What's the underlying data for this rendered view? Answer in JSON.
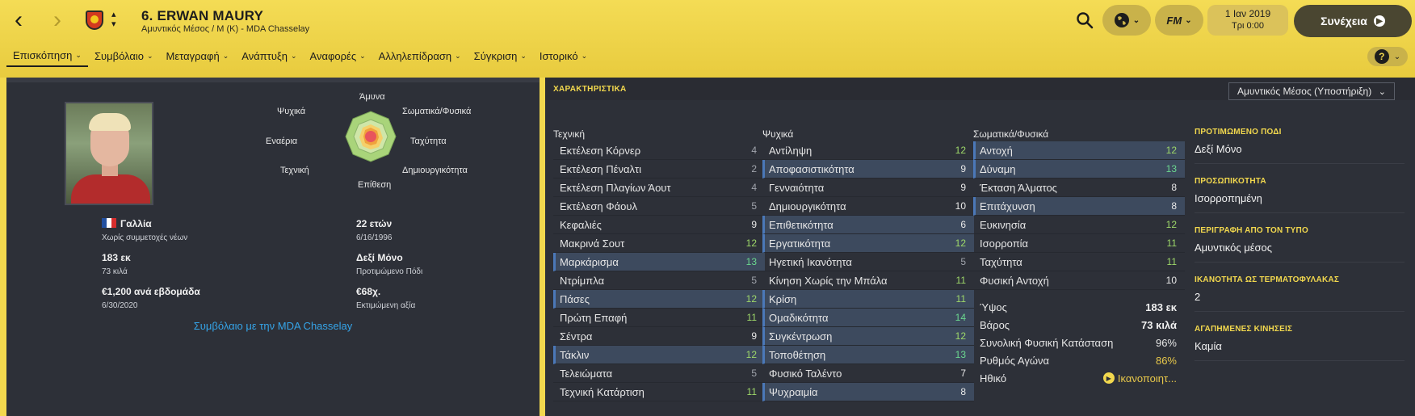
{
  "header": {
    "player_title": "6. ERWAN MAURY",
    "player_sub": "Αμυντικός Μέσος / Μ (Κ) - MDA Chasselay",
    "date": "1 Ιαν 2019",
    "time": "Τρι 0:00",
    "continue_label": "Συνέχεια",
    "fm_label": "FM"
  },
  "tabs": [
    {
      "label": "Επισκόπηση"
    },
    {
      "label": "Συμβόλαιο"
    },
    {
      "label": "Μεταγραφή"
    },
    {
      "label": "Ανάπτυξη"
    },
    {
      "label": "Αναφορές"
    },
    {
      "label": "Αλληλεπίδραση"
    },
    {
      "label": "Σύγκριση"
    },
    {
      "label": "Ιστορικό"
    }
  ],
  "radar": {
    "labels": {
      "defence": "Άμυνα",
      "physical": "Σωματικά/Φυσικά",
      "speed": "Ταχύτητα",
      "creativity": "Δημιουργικότητα",
      "attack": "Επίθεση",
      "technique": "Τεχνική",
      "aerial": "Εναέρια",
      "mental": "Ψυχικά"
    }
  },
  "profile": {
    "nationality": "Γαλλία",
    "youth_caps": "Χωρίς συμμετοχές νέων",
    "age": "22 ετών",
    "dob": "6/16/1996",
    "height": "183 εκ",
    "weight": "73 κιλά",
    "foot": "Δεξί Μόνο",
    "foot_label": "Προτιμώμενο Πόδι",
    "wage": "€1,200 ανά εβδομάδα",
    "contract_end": "6/30/2020",
    "value": "€68χ.",
    "value_label": "Εκτιμώμενη αξία",
    "contract_link": "Συμβόλαιο με την MDA Chasselay"
  },
  "attributes": {
    "title": "ΧΑΡΑΚΤΗΡΙΣΤΙΚΑ",
    "role_select": "Αμυντικός Μέσος (Υποστήριξη)",
    "technical": {
      "title": "Τεχνική",
      "rows": [
        {
          "name": "Εκτέλεση Κόρνερ",
          "value": "4",
          "hl": false
        },
        {
          "name": "Εκτέλεση Πέναλτι",
          "value": "2",
          "hl": false
        },
        {
          "name": "Εκτέλεση Πλαγίων Άουτ",
          "value": "4",
          "hl": false
        },
        {
          "name": "Εκτέλεση Φάουλ",
          "value": "5",
          "hl": false
        },
        {
          "name": "Κεφαλιές",
          "value": "9",
          "hl": false
        },
        {
          "name": "Μακρινά Σουτ",
          "value": "12",
          "hl": false
        },
        {
          "name": "Μαρκάρισμα",
          "value": "13",
          "hl": true
        },
        {
          "name": "Ντρίμπλα",
          "value": "5",
          "hl": false
        },
        {
          "name": "Πάσες",
          "value": "12",
          "hl": true
        },
        {
          "name": "Πρώτη Επαφή",
          "value": "11",
          "hl": false
        },
        {
          "name": "Σέντρα",
          "value": "9",
          "hl": false
        },
        {
          "name": "Τάκλιν",
          "value": "12",
          "hl": true
        },
        {
          "name": "Τελειώματα",
          "value": "5",
          "hl": false
        },
        {
          "name": "Τεχνική Κατάρτιση",
          "value": "11",
          "hl": false
        }
      ]
    },
    "mental": {
      "title": "Ψυχικά",
      "rows": [
        {
          "name": "Αντίληψη",
          "value": "12",
          "hl": false
        },
        {
          "name": "Αποφασιστικότητα",
          "value": "9",
          "hl": true
        },
        {
          "name": "Γενναιότητα",
          "value": "9",
          "hl": false
        },
        {
          "name": "Δημιουργικότητα",
          "value": "10",
          "hl": false
        },
        {
          "name": "Επιθετικότητα",
          "value": "6",
          "hl": true
        },
        {
          "name": "Εργατικότητα",
          "value": "12",
          "hl": true
        },
        {
          "name": "Ηγετική Ικανότητα",
          "value": "5",
          "hl": false
        },
        {
          "name": "Κίνηση Χωρίς την Μπάλα",
          "value": "11",
          "hl": false
        },
        {
          "name": "Κρίση",
          "value": "11",
          "hl": true
        },
        {
          "name": "Ομαδικότητα",
          "value": "14",
          "hl": true
        },
        {
          "name": "Συγκέντρωση",
          "value": "12",
          "hl": true
        },
        {
          "name": "Τοποθέτηση",
          "value": "13",
          "hl": true
        },
        {
          "name": "Φυσικό Ταλέντο",
          "value": "7",
          "hl": false
        },
        {
          "name": "Ψυχραιμία",
          "value": "8",
          "hl": true
        }
      ]
    },
    "physical": {
      "title": "Σωματικά/Φυσικά",
      "rows": [
        {
          "name": "Αντοχή",
          "value": "12",
          "hl": true
        },
        {
          "name": "Δύναμη",
          "value": "13",
          "hl": true
        },
        {
          "name": "Έκταση Άλματος",
          "value": "8",
          "hl": false
        },
        {
          "name": "Επιτάχυνση",
          "value": "8",
          "hl": true
        },
        {
          "name": "Ευκινησία",
          "value": "12",
          "hl": false
        },
        {
          "name": "Ισορροπία",
          "value": "11",
          "hl": false
        },
        {
          "name": "Ταχύτητα",
          "value": "11",
          "hl": false
        },
        {
          "name": "Φυσική Αντοχή",
          "value": "10",
          "hl": false
        }
      ],
      "extra": {
        "height_label": "Ύψος",
        "height": "183 εκ",
        "weight_label": "Βάρος",
        "weight": "73 κιλά",
        "condition_label": "Συνολική Φυσική Κατάσταση",
        "condition": "96%",
        "sharpness_label": "Ρυθμός Αγώνα",
        "sharpness": "86%",
        "morale_label": "Ηθικό",
        "morale": "Ικανοποιητ..."
      }
    }
  },
  "side_info": [
    {
      "label": "ΠΡΟΤΙΜΩΜΕΝΟ ΠΟΔΙ",
      "value": "Δεξί Μόνο"
    },
    {
      "label": "ΠΡΟΣΩΠΙΚΟΤΗΤΑ",
      "value": "Ισορροπημένη"
    },
    {
      "label": "ΠΕΡΙΓΡΑΦΗ ΑΠΟ ΤΟΝ ΤΥΠΟ",
      "value": "Αμυντικός μέσος"
    },
    {
      "label": "ΙΚΑΝΟΤΗΤΑ ΩΣ ΤΕΡΜΑΤΟΦΥΛΑΚΑΣ",
      "value": "2"
    },
    {
      "label": "ΑΓΑΠΗΜΕΝΕΣ ΚΙΝΗΣΕΙΣ",
      "value": "Καμία"
    }
  ]
}
